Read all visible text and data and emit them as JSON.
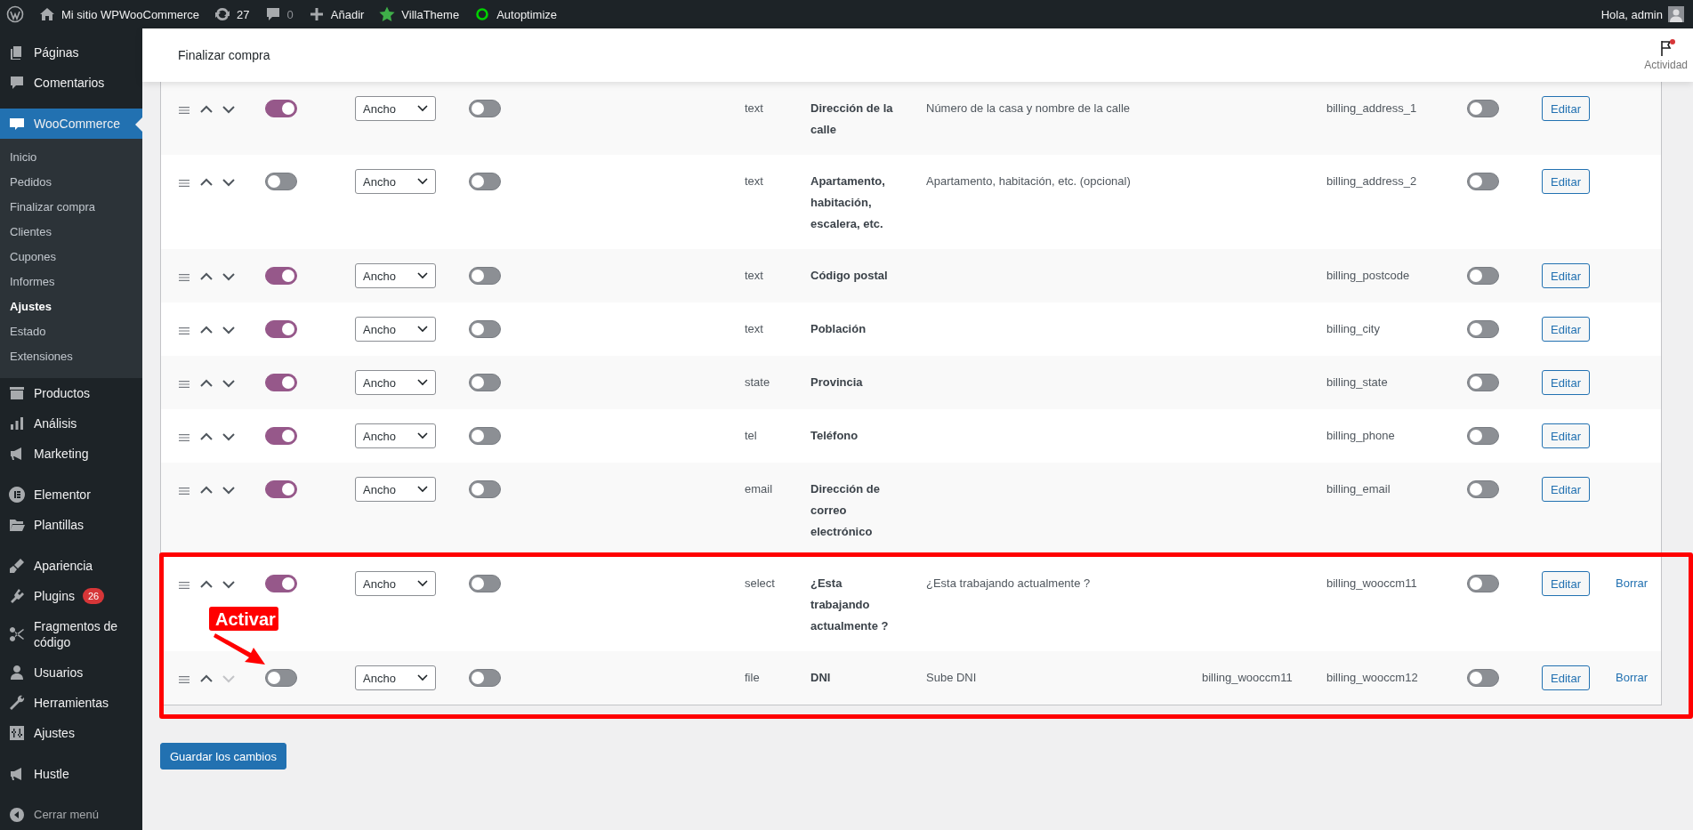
{
  "admin_bar": {
    "site": "Mi sitio WPWooCommerce",
    "updates": "27",
    "comments": "0",
    "new": "Añadir",
    "items": [
      {
        "label": "VillaTheme",
        "kind": "star"
      },
      {
        "label": "Autoptimize",
        "kind": "ring"
      }
    ],
    "greeting": "Hola, admin"
  },
  "sidebar": {
    "groups": [
      {
        "items": [
          {
            "label": "Páginas",
            "kind": "pages",
            "selected": false
          },
          {
            "label": "Comentarios",
            "kind": "comments",
            "selected": false
          }
        ]
      },
      {
        "items": [
          {
            "label": "WooCommerce",
            "kind": "woo",
            "selected": true,
            "children": [
              {
                "label": "Inicio",
                "selected": false
              },
              {
                "label": "Pedidos",
                "selected": false
              },
              {
                "label": "Finalizar compra",
                "selected": false
              },
              {
                "label": "Clientes",
                "selected": false
              },
              {
                "label": "Cupones",
                "selected": false
              },
              {
                "label": "Informes",
                "selected": false
              },
              {
                "label": "Ajustes",
                "selected": true
              },
              {
                "label": "Estado",
                "selected": false
              },
              {
                "label": "Extensiones",
                "selected": false
              }
            ]
          },
          {
            "label": "Productos",
            "kind": "products",
            "selected": false
          },
          {
            "label": "Análisis",
            "kind": "analytics",
            "selected": false
          },
          {
            "label": "Marketing",
            "kind": "marketing",
            "selected": false
          }
        ]
      },
      {
        "items": [
          {
            "label": "Elementor",
            "kind": "elementor",
            "selected": false
          },
          {
            "label": "Plantillas",
            "kind": "templates",
            "selected": false
          }
        ]
      },
      {
        "items": [
          {
            "label": "Apariencia",
            "kind": "appearance",
            "selected": false
          },
          {
            "label": "Plugins",
            "kind": "plugins",
            "selected": false,
            "badge": "26"
          },
          {
            "label": "Fragmentos de código",
            "kind": "snippets",
            "selected": false
          },
          {
            "label": "Usuarios",
            "kind": "users",
            "selected": false
          },
          {
            "label": "Herramientas",
            "kind": "tools",
            "selected": false
          },
          {
            "label": "Ajustes",
            "kind": "settings",
            "selected": false
          }
        ]
      },
      {
        "items": [
          {
            "label": "Hustle",
            "kind": "hustle",
            "selected": false
          }
        ]
      }
    ],
    "collapse": "Cerrar menú"
  },
  "header": {
    "title": "Finalizar compra",
    "activity": "Actividad",
    "unread": true
  },
  "rows": [
    {
      "active": true,
      "width": "Ancho",
      "switch_2_on": false,
      "type": "text",
      "label": "Dirección de la calle",
      "placeholder": "Número de la casa y nombre de la calle",
      "name": "billing_address_1",
      "switch_3_on": false,
      "edit": "Editar",
      "move_down_disabled": false,
      "highlighted": false
    },
    {
      "active": false,
      "width": "Ancho",
      "switch_2_on": false,
      "type": "text",
      "label": "Apartamento, habitación, escalera, etc.",
      "placeholder": "Apartamento, habitación, etc. (opcional)",
      "name": "billing_address_2",
      "switch_3_on": false,
      "edit": "Editar",
      "move_down_disabled": false,
      "highlighted": false
    },
    {
      "active": true,
      "width": "Ancho",
      "switch_2_on": false,
      "type": "text",
      "label": "Código postal",
      "name": "billing_postcode",
      "switch_3_on": false,
      "edit": "Editar",
      "move_down_disabled": false,
      "highlighted": false
    },
    {
      "active": true,
      "width": "Ancho",
      "switch_2_on": false,
      "type": "text",
      "label": "Población",
      "name": "billing_city",
      "switch_3_on": false,
      "edit": "Editar",
      "move_down_disabled": false,
      "highlighted": false
    },
    {
      "active": true,
      "width": "Ancho",
      "switch_2_on": false,
      "type": "state",
      "label": "Provincia",
      "name": "billing_state",
      "switch_3_on": false,
      "edit": "Editar",
      "move_down_disabled": false,
      "highlighted": false
    },
    {
      "active": true,
      "width": "Ancho",
      "switch_2_on": false,
      "type": "tel",
      "label": "Teléfono",
      "name": "billing_phone",
      "switch_3_on": false,
      "edit": "Editar",
      "move_down_disabled": false,
      "highlighted": false
    },
    {
      "active": true,
      "width": "Ancho",
      "switch_2_on": false,
      "type": "email",
      "label": "Dirección de correo electrónico",
      "name": "billing_email",
      "switch_3_on": false,
      "edit": "Editar",
      "move_down_disabled": false,
      "highlighted": false
    },
    {
      "active": true,
      "width": "Ancho",
      "switch_2_on": false,
      "type": "select",
      "label": "¿Esta trabajando actualmente ?",
      "placeholder": "¿Esta trabajando actualmente ?",
      "name": "billing_wooccm11",
      "switch_3_on": false,
      "edit": "Editar",
      "delete": "Borrar",
      "move_down_disabled": false,
      "highlighted": true
    },
    {
      "active": false,
      "width": "Ancho",
      "switch_2_on": false,
      "type": "file",
      "label": "DNI",
      "placeholder": "Sube DNI",
      "column_9": "billing_wooccm11",
      "name": "billing_wooccm12",
      "switch_3_on": false,
      "edit": "Editar",
      "delete": "Borrar",
      "move_down_disabled": true,
      "highlighted": true,
      "callout": "Activar"
    }
  ],
  "save_button": "Guardar los cambios"
}
